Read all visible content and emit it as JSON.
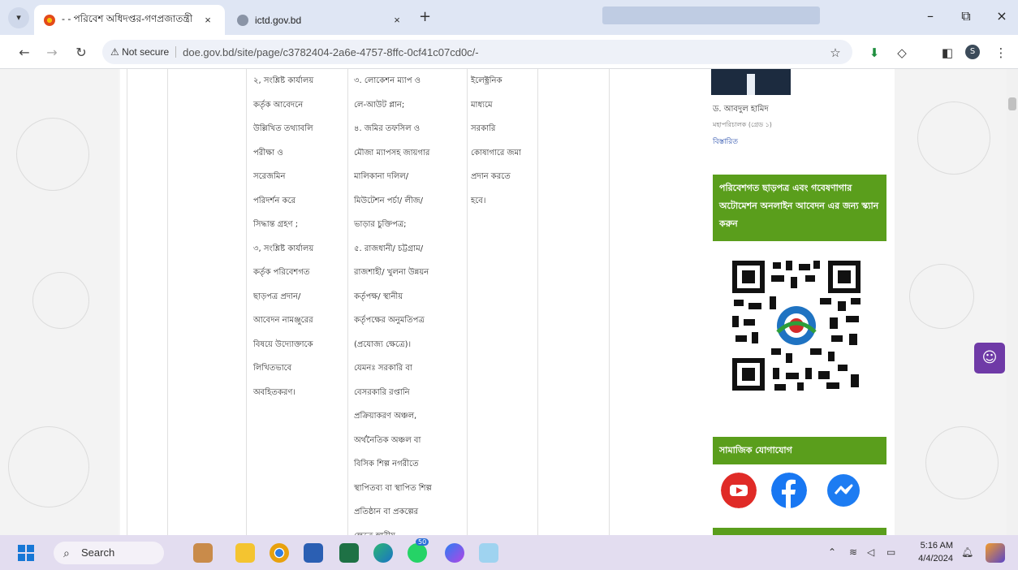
{
  "browser": {
    "tabs": [
      {
        "title": "- - পরিবেশ অধিদপ্তর-গণপ্রজাতন্ত্রী",
        "close": "×"
      },
      {
        "title": "ictd.gov.bd",
        "close": "×"
      }
    ],
    "new_tab": "+",
    "window_controls": {
      "minimize": "–",
      "restore": "⧉",
      "close": "×"
    },
    "security_label": "Not secure",
    "url": "doe.gov.bd/site/page/c3782404-2a6e-4757-8ffc-0cf41c07cd0c/-",
    "profile_initial": "S"
  },
  "table": {
    "col3_lines": [
      "২, সংশ্লিষ্ট কার্যালয়",
      "কর্তৃক   আবেদনে",
      "উল্লিখিত  তথ্যাবলি",
      "পরীক্ষা          ও",
      "সরেজমিন",
      "পরিদর্শন       করে",
      "সিদ্ধান্ত গ্রহণ ;",
      "৩, সংশ্লিষ্ট কার্যালয়",
      "কর্তৃক পরিবেশগত",
      "ছাড়পত্র     প্রদান/",
      "আবেদন নামঞ্জুরের",
      "বিষয়ে উদ্যোক্তাকে",
      "লিখিতভাবে",
      "অবহিতকরণ।"
    ],
    "col4_lines": [
      "৩. লোকেশন ম্যাপ ও",
      "লে-আউট প্লান;",
      "৪. জমির তফসিল ও",
      "মৌজা ম্যাপসহ জায়গার",
      "মালিকানা        দলিল/",
      "মিউটেশন পর্চা/ লীজ/",
      "ভাড়ার চুক্তিপত্র;",
      "৫. রাজধানী/ চট্টগ্রাম/",
      "রাজশাহী/ খুলনা উন্নয়ন",
      "কর্তৃপক্ষ/         স্থানীয়",
      "কর্তৃপক্ষের    অনুমতিপত্র",
      "(প্রযোজ্য          ক্ষেত্রে)।",
      "যেমনঃ   সরকারি    বা",
      "বেসরকারি         রপ্তানি",
      "প্রক্রিয়াকরণ        অঞ্চল,",
      "অর্থনৈতিক   অঞ্চল   বা",
      "বিসিক  শিল্প  নগরীতে",
      "স্থাপিতব্য বা স্থাপিত শিল্প",
      "প্রতিষ্ঠান   বা   প্রকল্পের",
      "ক্ষেত্রে               স্থানীয়"
    ],
    "col5_lines": [
      "ইলেক্ট্রনিক",
      "মাধ্যমে",
      "সরকারি",
      "কোষাগারে জমা",
      "প্রদান     করতে",
      "হবে।"
    ]
  },
  "sidebar": {
    "dg_name": "ড. আবদুল হামিদ",
    "dg_designation": "মহাপরিচালক (গ্রেড ১)",
    "details_link": "বিস্তারিত",
    "clearance_box": "পরিবেশগত ছাড়পত্র এবং গবেষণাগার অটোমেশন অনলাইন আবেদন এর জন্য স্ক্যান করুন",
    "social_title": "সামাজিক যোগাযোগ",
    "colors": {
      "green": "#5a9e1c",
      "youtube": "#e02b27",
      "facebook": "#1877f2",
      "messenger": "#1d7cf2"
    }
  },
  "accessibility_button": "accessibility-icon",
  "taskbar": {
    "search_label": "Search",
    "time": "5:16 AM",
    "date": "4/4/2024",
    "apps": [
      "deer-widget-icon",
      "file-explorer-icon",
      "chrome-icon",
      "word-icon",
      "excel-icon",
      "edge-icon",
      "whatsapp-icon",
      "messenger-icon",
      "notepad-icon"
    ],
    "whatsapp_badge": "50"
  }
}
